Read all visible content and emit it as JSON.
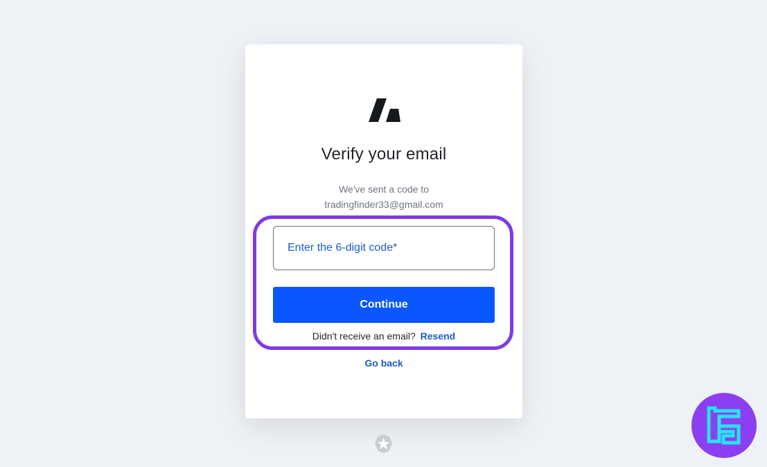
{
  "page": {
    "title": "Verify your email",
    "subtitle_line1": "We've sent a code to",
    "email": "tradingfinder33@gmail.com"
  },
  "form": {
    "code_placeholder": "Enter the 6-digit code*",
    "code_value": "",
    "continue_label": "Continue",
    "resend_prompt": "Didn't receive an email?",
    "resend_label": "Resend",
    "go_back_label": "Go back"
  },
  "icons": {
    "brand_logo": "brand-slash-logo",
    "footer_badge": "auth0-star-badge",
    "watermark": "tradingfinder-logo"
  },
  "colors": {
    "page_background": "#eef1f5",
    "primary_button": "#0a57ff",
    "link": "#1b5cc8",
    "highlight": "#7e3ae6",
    "watermark_bg": "#8b3ff0",
    "watermark_glyph": "#27e3f5"
  }
}
